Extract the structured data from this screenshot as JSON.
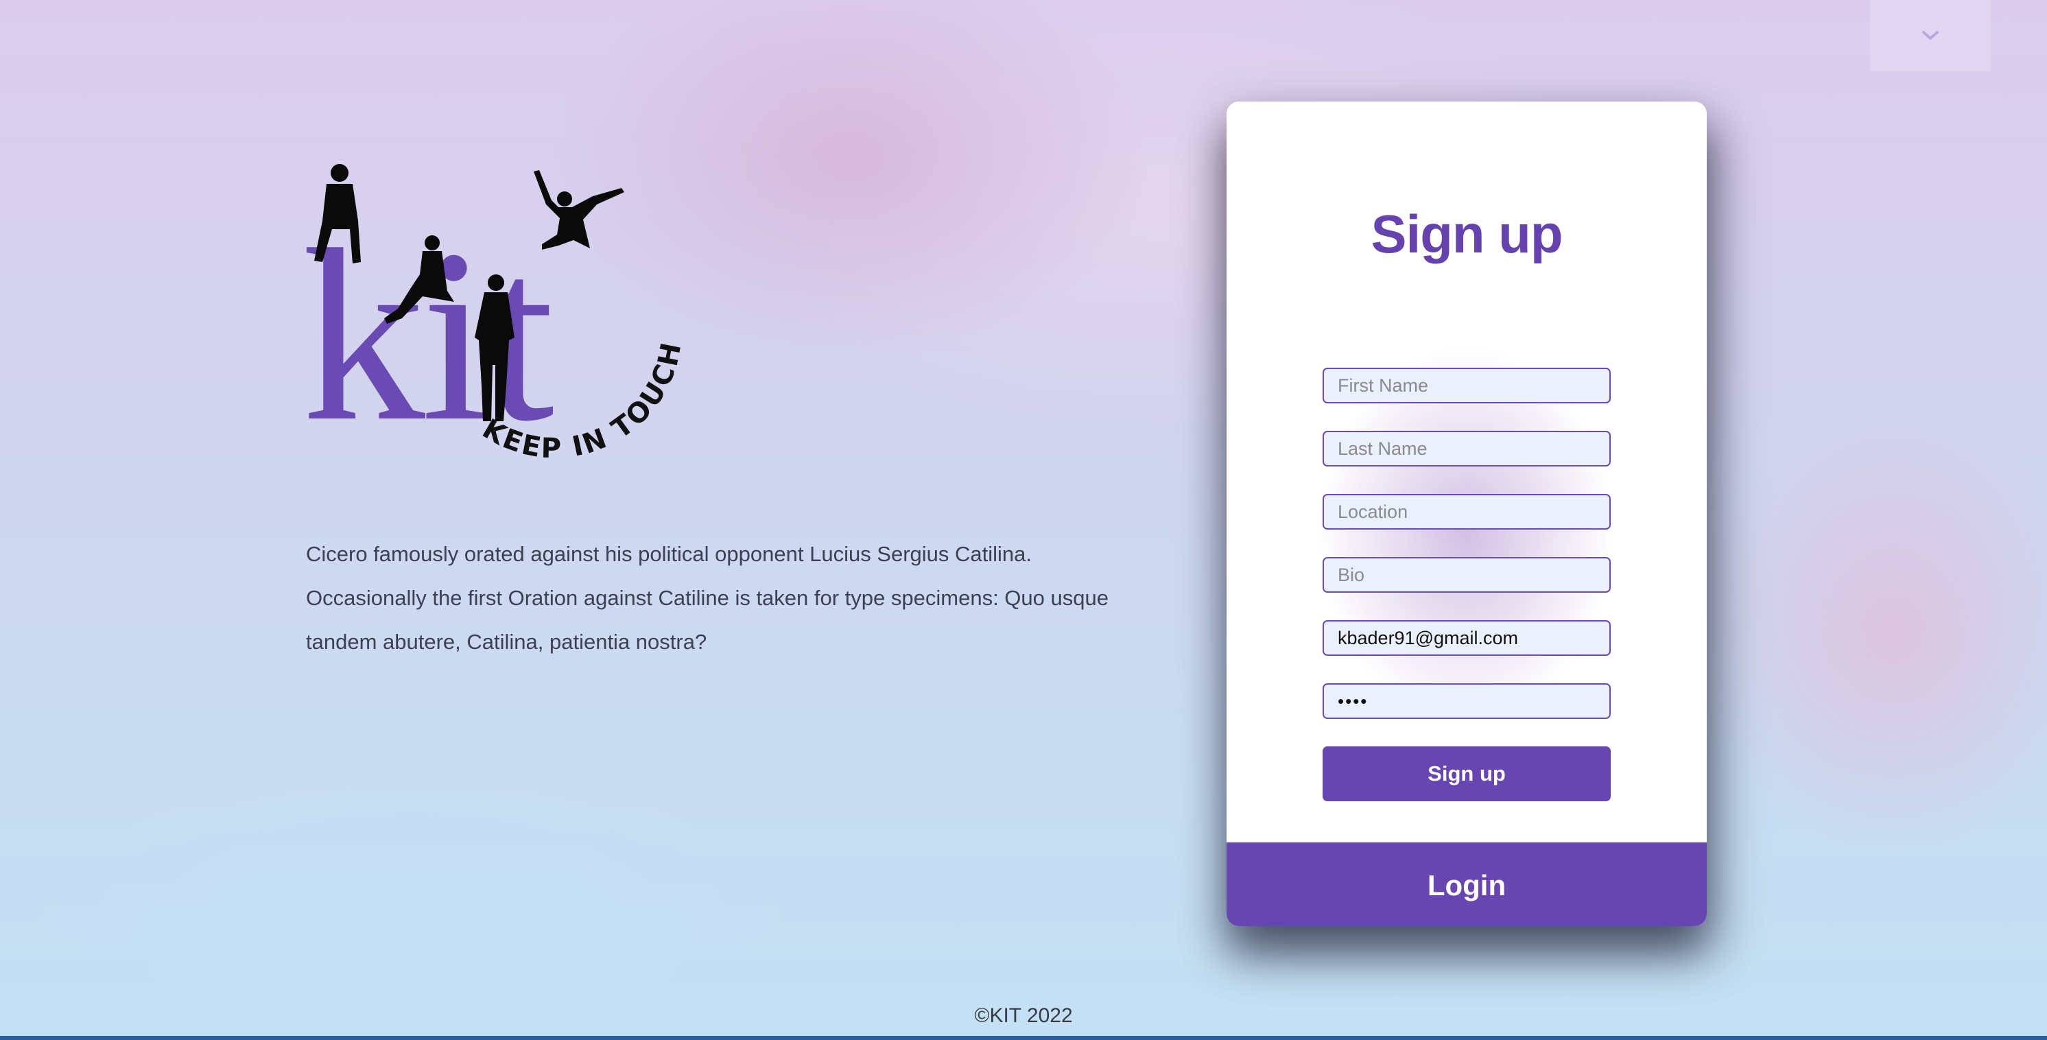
{
  "header": {
    "dropdown_icon": "chevron-down-icon"
  },
  "logo": {
    "letters": "kit",
    "tagline": "KEEP IN TOUCH",
    "color": "#6a4bb4"
  },
  "intro": {
    "text": "Cicero famously orated against his political opponent Lucius Sergius Catilina. Occasionally the first Oration against Catiline is taken for type specimens: Quo usque tandem abutere, Catilina, patientia nostra?"
  },
  "signup_form": {
    "title": "Sign up",
    "first_name": {
      "placeholder": "First Name",
      "value": ""
    },
    "last_name": {
      "placeholder": "Last Name",
      "value": ""
    },
    "location": {
      "placeholder": "Location",
      "value": ""
    },
    "bio": {
      "placeholder": "Bio",
      "value": ""
    },
    "email": {
      "placeholder": "",
      "value": "kbader91@gmail.com"
    },
    "password": {
      "placeholder": "",
      "value": "••••"
    },
    "submit_label": "Sign up",
    "login_label": "Login"
  },
  "footer": {
    "copyright": "©KIT 2022"
  },
  "colors": {
    "accent": "#6746b1",
    "field_border": "#6c4ab6",
    "field_bg": "#eaf0fc"
  }
}
